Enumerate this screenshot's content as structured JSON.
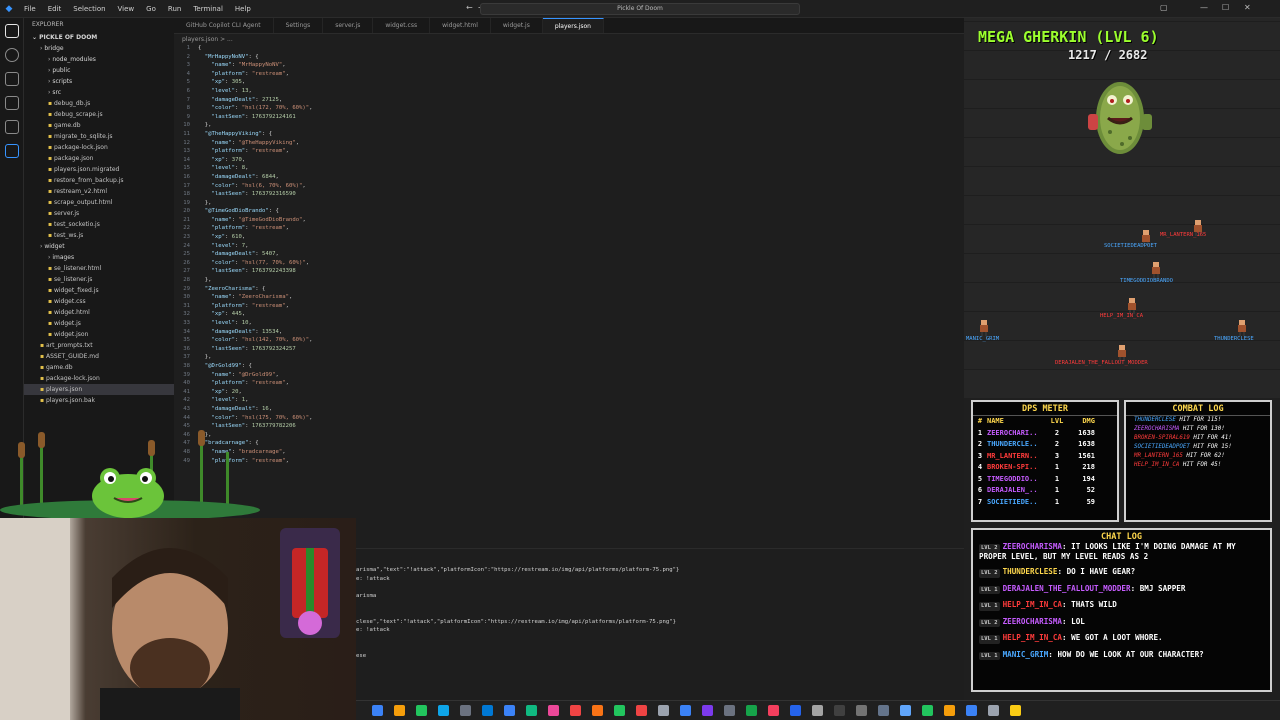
{
  "menu": [
    "File",
    "Edit",
    "Selection",
    "View",
    "Go",
    "Run",
    "Terminal",
    "Help"
  ],
  "command_center": "Pickle Of Doom",
  "explorer": {
    "header": "EXPLORER",
    "root": "PICKLE OF DOOM",
    "items": [
      {
        "label": "bridge",
        "folder": true,
        "depth": 1
      },
      {
        "label": "node_modules",
        "folder": true,
        "depth": 2
      },
      {
        "label": "public",
        "folder": true,
        "depth": 2
      },
      {
        "label": "scripts",
        "folder": true,
        "depth": 2
      },
      {
        "label": "src",
        "folder": true,
        "depth": 2
      },
      {
        "label": "debug_db.js",
        "depth": 2
      },
      {
        "label": "debug_scrape.js",
        "depth": 2
      },
      {
        "label": "game.db",
        "depth": 2
      },
      {
        "label": "migrate_to_sqlite.js",
        "depth": 2
      },
      {
        "label": "package-lock.json",
        "depth": 2
      },
      {
        "label": "package.json",
        "depth": 2
      },
      {
        "label": "players.json.migrated",
        "depth": 2
      },
      {
        "label": "restore_from_backup.js",
        "depth": 2
      },
      {
        "label": "restream_v2.html",
        "depth": 2
      },
      {
        "label": "scrape_output.html",
        "depth": 2
      },
      {
        "label": "server.js",
        "depth": 2
      },
      {
        "label": "test_socketio.js",
        "depth": 2
      },
      {
        "label": "test_ws.js",
        "depth": 2
      },
      {
        "label": "widget",
        "folder": true,
        "depth": 1
      },
      {
        "label": "images",
        "folder": true,
        "depth": 2
      },
      {
        "label": "se_listener.html",
        "depth": 2
      },
      {
        "label": "se_listener.js",
        "depth": 2
      },
      {
        "label": "widget_fixed.js",
        "depth": 2
      },
      {
        "label": "widget.css",
        "depth": 2
      },
      {
        "label": "widget.html",
        "depth": 2
      },
      {
        "label": "widget.js",
        "depth": 2
      },
      {
        "label": "widget.json",
        "depth": 2
      },
      {
        "label": "art_prompts.txt",
        "depth": 1
      },
      {
        "label": "ASSET_GUIDE.md",
        "depth": 1
      },
      {
        "label": "game.db",
        "depth": 1
      },
      {
        "label": "package-lock.json",
        "depth": 1
      },
      {
        "label": "players.json",
        "depth": 1,
        "active": true
      },
      {
        "label": "players.json.bak",
        "depth": 1
      }
    ]
  },
  "tabs": [
    "GitHub Copilot CLI Agent",
    "Settings",
    "server.js",
    "widget.css",
    "widget.html",
    "widget.js",
    "players.json"
  ],
  "breadcrumb": "players.json > ...",
  "code_lines": [
    [
      [
        "p",
        "{"
      ]
    ],
    [
      [
        "k",
        "  \"MrHappyNoNV\""
      ],
      [
        "p",
        ": {"
      ]
    ],
    [
      [
        "k",
        "    \"name\""
      ],
      [
        "p",
        ": "
      ],
      [
        "s",
        "\"MrHappyNoNV\""
      ],
      [
        "p",
        ","
      ]
    ],
    [
      [
        "k",
        "    \"platform\""
      ],
      [
        "p",
        ": "
      ],
      [
        "s",
        "\"restream\""
      ],
      [
        "p",
        ","
      ]
    ],
    [
      [
        "k",
        "    \"xp\""
      ],
      [
        "p",
        ": "
      ],
      [
        "n",
        "305"
      ],
      [
        "p",
        ","
      ]
    ],
    [
      [
        "k",
        "    \"level\""
      ],
      [
        "p",
        ": "
      ],
      [
        "n",
        "13"
      ],
      [
        "p",
        ","
      ]
    ],
    [
      [
        "k",
        "    \"damageDealt\""
      ],
      [
        "p",
        ": "
      ],
      [
        "n",
        "27125"
      ],
      [
        "p",
        ","
      ]
    ],
    [
      [
        "k",
        "    \"color\""
      ],
      [
        "p",
        ": "
      ],
      [
        "s",
        "\"hsl(172, 70%, 60%)\""
      ],
      [
        "p",
        ","
      ]
    ],
    [
      [
        "k",
        "    \"lastSeen\""
      ],
      [
        "p",
        ": "
      ],
      [
        "n",
        "1763792124161"
      ]
    ],
    [
      [
        "p",
        "  },"
      ]
    ],
    [
      [
        "k",
        "  \"@TheHappyViking\""
      ],
      [
        "p",
        ": {"
      ]
    ],
    [
      [
        "k",
        "    \"name\""
      ],
      [
        "p",
        ": "
      ],
      [
        "s",
        "\"@TheHappyViking\""
      ],
      [
        "p",
        ","
      ]
    ],
    [
      [
        "k",
        "    \"platform\""
      ],
      [
        "p",
        ": "
      ],
      [
        "s",
        "\"restream\""
      ],
      [
        "p",
        ","
      ]
    ],
    [
      [
        "k",
        "    \"xp\""
      ],
      [
        "p",
        ": "
      ],
      [
        "n",
        "370"
      ],
      [
        "p",
        ","
      ]
    ],
    [
      [
        "k",
        "    \"level\""
      ],
      [
        "p",
        ": "
      ],
      [
        "n",
        "8"
      ],
      [
        "p",
        ","
      ]
    ],
    [
      [
        "k",
        "    \"damageDealt\""
      ],
      [
        "p",
        ": "
      ],
      [
        "n",
        "6844"
      ],
      [
        "p",
        ","
      ]
    ],
    [
      [
        "k",
        "    \"color\""
      ],
      [
        "p",
        ": "
      ],
      [
        "s",
        "\"hsl(6, 70%, 60%)\""
      ],
      [
        "p",
        ","
      ]
    ],
    [
      [
        "k",
        "    \"lastSeen\""
      ],
      [
        "p",
        ": "
      ],
      [
        "n",
        "1763792316590"
      ]
    ],
    [
      [
        "p",
        "  },"
      ]
    ],
    [
      [
        "k",
        "  \"@TimeGodDioBrando\""
      ],
      [
        "p",
        ": {"
      ]
    ],
    [
      [
        "k",
        "    \"name\""
      ],
      [
        "p",
        ": "
      ],
      [
        "s",
        "\"@TimeGodDioBrando\""
      ],
      [
        "p",
        ","
      ]
    ],
    [
      [
        "k",
        "    \"platform\""
      ],
      [
        "p",
        ": "
      ],
      [
        "s",
        "\"restream\""
      ],
      [
        "p",
        ","
      ]
    ],
    [
      [
        "k",
        "    \"xp\""
      ],
      [
        "p",
        ": "
      ],
      [
        "n",
        "610"
      ],
      [
        "p",
        ","
      ]
    ],
    [
      [
        "k",
        "    \"level\""
      ],
      [
        "p",
        ": "
      ],
      [
        "n",
        "7"
      ],
      [
        "p",
        ","
      ]
    ],
    [
      [
        "k",
        "    \"damageDealt\""
      ],
      [
        "p",
        ": "
      ],
      [
        "n",
        "5407"
      ],
      [
        "p",
        ","
      ]
    ],
    [
      [
        "k",
        "    \"color\""
      ],
      [
        "p",
        ": "
      ],
      [
        "s",
        "\"hsl(77, 70%, 60%)\""
      ],
      [
        "p",
        ","
      ]
    ],
    [
      [
        "k",
        "    \"lastSeen\""
      ],
      [
        "p",
        ": "
      ],
      [
        "n",
        "1763792243398"
      ]
    ],
    [
      [
        "p",
        "  },"
      ]
    ],
    [
      [
        "k",
        "  \"ZeeroCharisma\""
      ],
      [
        "p",
        ": {"
      ]
    ],
    [
      [
        "k",
        "    \"name\""
      ],
      [
        "p",
        ": "
      ],
      [
        "s",
        "\"ZeeroCharisma\""
      ],
      [
        "p",
        ","
      ]
    ],
    [
      [
        "k",
        "    \"platform\""
      ],
      [
        "p",
        ": "
      ],
      [
        "s",
        "\"restream\""
      ],
      [
        "p",
        ","
      ]
    ],
    [
      [
        "k",
        "    \"xp\""
      ],
      [
        "p",
        ": "
      ],
      [
        "n",
        "445"
      ],
      [
        "p",
        ","
      ]
    ],
    [
      [
        "k",
        "    \"level\""
      ],
      [
        "p",
        ": "
      ],
      [
        "n",
        "10"
      ],
      [
        "p",
        ","
      ]
    ],
    [
      [
        "k",
        "    \"damageDealt\""
      ],
      [
        "p",
        ": "
      ],
      [
        "n",
        "13534"
      ],
      [
        "p",
        ","
      ]
    ],
    [
      [
        "k",
        "    \"color\""
      ],
      [
        "p",
        ": "
      ],
      [
        "s",
        "\"hsl(142, 70%, 60%)\""
      ],
      [
        "p",
        ","
      ]
    ],
    [
      [
        "k",
        "    \"lastSeen\""
      ],
      [
        "p",
        ": "
      ],
      [
        "n",
        "1763792324257"
      ]
    ],
    [
      [
        "p",
        "  },"
      ]
    ],
    [
      [
        "k",
        "  \"@DrGold99\""
      ],
      [
        "p",
        ": {"
      ]
    ],
    [
      [
        "k",
        "    \"name\""
      ],
      [
        "p",
        ": "
      ],
      [
        "s",
        "\"@DrGold99\""
      ],
      [
        "p",
        ","
      ]
    ],
    [
      [
        "k",
        "    \"platform\""
      ],
      [
        "p",
        ": "
      ],
      [
        "s",
        "\"restream\""
      ],
      [
        "p",
        ","
      ]
    ],
    [
      [
        "k",
        "    \"xp\""
      ],
      [
        "p",
        ": "
      ],
      [
        "n",
        "20"
      ],
      [
        "p",
        ","
      ]
    ],
    [
      [
        "k",
        "    \"level\""
      ],
      [
        "p",
        ": "
      ],
      [
        "n",
        "1"
      ],
      [
        "p",
        ","
      ]
    ],
    [
      [
        "k",
        "    \"damageDealt\""
      ],
      [
        "p",
        ": "
      ],
      [
        "n",
        "16"
      ],
      [
        "p",
        ","
      ]
    ],
    [
      [
        "k",
        "    \"color\""
      ],
      [
        "p",
        ": "
      ],
      [
        "s",
        "\"hsl(175, 70%, 60%)\""
      ],
      [
        "p",
        ","
      ]
    ],
    [
      [
        "k",
        "    \"lastSeen\""
      ],
      [
        "p",
        ": "
      ],
      [
        "n",
        "1763779782206"
      ]
    ],
    [
      [
        "p",
        "  },"
      ]
    ],
    [
      [
        "k",
        "  \"bradcarnage\""
      ],
      [
        "p",
        ": {"
      ]
    ],
    [
      [
        "k",
        "    \"name\""
      ],
      [
        "p",
        ": "
      ],
      [
        "s",
        "\"bradcarnage\""
      ],
      [
        "p",
        ","
      ]
    ],
    [
      [
        "k",
        "    \"platform\""
      ],
      [
        "p",
        ": "
      ],
      [
        "s",
        "\"restream\""
      ],
      [
        "p",
        ","
      ]
    ]
  ],
  "terminal_lines": [
    "",
    "",
    "arisma\",\"text\":\"!attack\",\"platformIcon\":\"https://restream.io/img/api/platforms/platform-75.png\"}",
    "e: !attack",
    "",
    "arisma",
    "",
    "",
    "clese\",\"text\":\"!attack\",\"platformIcon\":\"https://restream.io/img/api/platforms/platform-75.png\"}",
    "e: !attack",
    "",
    "",
    "ese"
  ],
  "game": {
    "boss_title": "MEGA GHERKIN (LVL 6)",
    "boss_hp": "1217 / 2682",
    "sprites": [
      {
        "name": "MANIC_GRIM",
        "color": "#4aa8ff"
      },
      {
        "name": "SOCIETIEDEADPOET",
        "color": "#4aa8ff"
      },
      {
        "name": "HELP_IM_IN_CA",
        "color": "#ff3b3b"
      },
      {
        "name": "DERAJALEN_THE_FALLOUT_MODDER",
        "color": "#ff3b3b"
      },
      {
        "name": "TIMEGODDIOBRANDO",
        "color": "#4aa8ff"
      },
      {
        "name": "MR_LANTERN_165",
        "color": "#ff3b3b"
      },
      {
        "name": "THUNDERCLESE",
        "color": "#4aa8ff"
      }
    ]
  },
  "dps": {
    "title": "DPS METER",
    "headers": [
      "#",
      "NAME",
      "LVL",
      "DMG"
    ],
    "rows": [
      {
        "rank": "1",
        "name": "ZEEROCHARI..",
        "lvl": "2",
        "dmg": "1638",
        "color": "#c65cff"
      },
      {
        "rank": "2",
        "name": "THUNDERCLE..",
        "lvl": "2",
        "dmg": "1638",
        "color": "#4aa8ff"
      },
      {
        "rank": "3",
        "name": "MR_LANTERN..",
        "lvl": "3",
        "dmg": "1561",
        "color": "#ff3b3b"
      },
      {
        "rank": "4",
        "name": "BROKEN-SPI..",
        "lvl": "1",
        "dmg": "218",
        "color": "#ff3b3b"
      },
      {
        "rank": "5",
        "name": "TIMEGODDIO..",
        "lvl": "1",
        "dmg": "194",
        "color": "#c65cff"
      },
      {
        "rank": "6",
        "name": "DERAJALEN_..",
        "lvl": "1",
        "dmg": "52",
        "color": "#c65cff"
      },
      {
        "rank": "7",
        "name": "SOCIETIEDE..",
        "lvl": "1",
        "dmg": "59",
        "color": "#4aa8ff"
      }
    ]
  },
  "combat": {
    "title": "COMBAT LOG",
    "entries": [
      {
        "who": "THUNDERCLESE",
        "text": "HIT FOR 115!",
        "color": "#4aa8ff"
      },
      {
        "who": "ZEEROCHARISMA",
        "text": "HIT FOR 130!",
        "color": "#c65cff"
      },
      {
        "who": "BROKEN-SPIRAL619",
        "text": "HIT FOR 41!",
        "color": "#ff3b3b"
      },
      {
        "who": "SOCIETIEDEADPOET",
        "text": "HIT FOR 15!",
        "color": "#4aa8ff"
      },
      {
        "who": "MR_LANTERN_165",
        "text": "HIT FOR 62!",
        "color": "#ff3b3b"
      },
      {
        "who": "HELP_IM_IN_CA",
        "text": "HIT FOR 45!",
        "color": "#ff3b3b"
      }
    ]
  },
  "chat": {
    "title": "CHAT LOG",
    "messages": [
      {
        "lvl": "LVL 2",
        "name": "ZEEROCHARISMA",
        "text": "IT LOOKS LIKE I'M DOING DAMAGE AT MY PROPER LEVEL, BUT MY LEVEL READS AS 2",
        "color": "#c65cff"
      },
      {
        "lvl": "LVL 2",
        "name": "THUNDERCLESE",
        "text": "DO I HAVE GEAR?",
        "color": "#ffd84d"
      },
      {
        "lvl": "LVL 1",
        "name": "DERAJALEN_THE_FALLOUT_MODDER",
        "text": "BMJ SAPPER",
        "color": "#c65cff"
      },
      {
        "lvl": "LVL 1",
        "name": "HELP_IM_IN_CA",
        "text": "THATS WILD",
        "color": "#ff3b3b"
      },
      {
        "lvl": "LVL 2",
        "name": "ZEEROCHARISMA",
        "text": "LOL",
        "color": "#c65cff"
      },
      {
        "lvl": "LVL 1",
        "name": "HELP_IM_IN_CA",
        "text": "WE GOT A LOOT WHORE.",
        "color": "#ff3b3b"
      },
      {
        "lvl": "LVL 1",
        "name": "MANIC_GRIM",
        "text": "HOW DO WE LOOK AT OUR CHARACTER?",
        "color": "#4aa8ff"
      }
    ]
  },
  "taskbar_colors": [
    "#3b82f6",
    "#f59e0b",
    "#22c55e",
    "#0ea5e9",
    "#6b7280",
    "#0078d4",
    "#3b82f6",
    "#10b981",
    "#ec4899",
    "#ef4444",
    "#f97316",
    "#22c55e",
    "#ef4444",
    "#9ca3af",
    "#3b82f6",
    "#7c3aed",
    "#6b7280",
    "#16a34a",
    "#f43f5e",
    "#2563eb",
    "#a3a3a3",
    "#404040",
    "#737373",
    "#64748b",
    "#60a5fa",
    "#22c55e",
    "#f59e0b",
    "#3b82f6",
    "#9ca3af",
    "#facc15"
  ]
}
